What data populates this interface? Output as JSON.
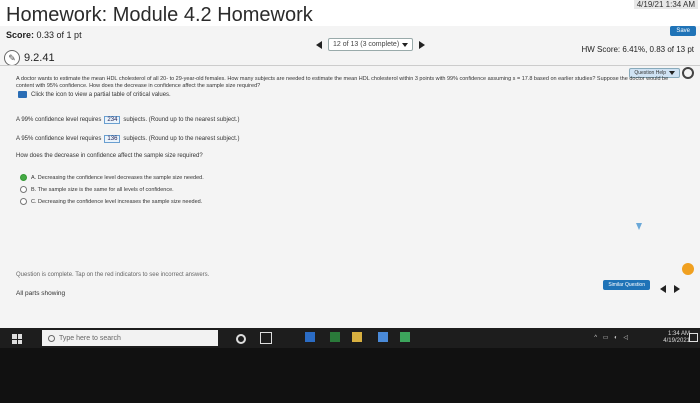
{
  "header": {
    "title": "Homework: Module 4.2 Homework",
    "clock": "4/19/21 1:34 AM",
    "save_label": "Save"
  },
  "score": {
    "label": "Score:",
    "value": "0.33 of 1 pt"
  },
  "nav": {
    "progress": "12 of 13 (3 complete)"
  },
  "hw_score": {
    "label": "HW Score:",
    "value": "6.41%, 0.83 of 13 pt"
  },
  "question": {
    "id": "9.2.41",
    "help_label": "Question Help",
    "text": "A doctor wants to estimate the mean HDL cholesterol of all 20- to 29-year-old females. How many subjects are needed to estimate the mean HDL cholesterol within 3 points with 99% confidence assuming s = 17.8 based on earlier studies? Suppose the doctor would be content with 95% confidence. How does the decrease in confidence affect the sample size required?",
    "hint": "Click the icon to view a partial table of critical values.",
    "line1": {
      "prefix": "A 99% confidence level requires",
      "value": "234",
      "suffix": "subjects. (Round up to the nearest subject.)"
    },
    "line2": {
      "prefix": "A 95% confidence level requires",
      "value": "136",
      "suffix": "subjects. (Round up to the nearest subject.)"
    },
    "line3": "How does the decrease in confidence affect the sample size required?",
    "options": [
      {
        "text": "A. Decreasing the confidence level decreases the sample size needed.",
        "selected": true
      },
      {
        "text": "B. The sample size is the same for all levels of confidence.",
        "selected": false
      },
      {
        "text": "C. Decreasing the confidence level increases the sample size needed.",
        "selected": false
      }
    ]
  },
  "footer": {
    "complete_note": "Question is complete. Tap on the red indicators to see incorrect answers.",
    "parts_label": "All parts showing",
    "similar_label": "Similar Question"
  },
  "taskbar": {
    "search_placeholder": "Type here to search",
    "time": "1:34 AM",
    "date": "4/19/2021"
  },
  "colors": {
    "accent": "#1f73b7",
    "correct": "#44aa44",
    "orange": "#f0a020"
  }
}
